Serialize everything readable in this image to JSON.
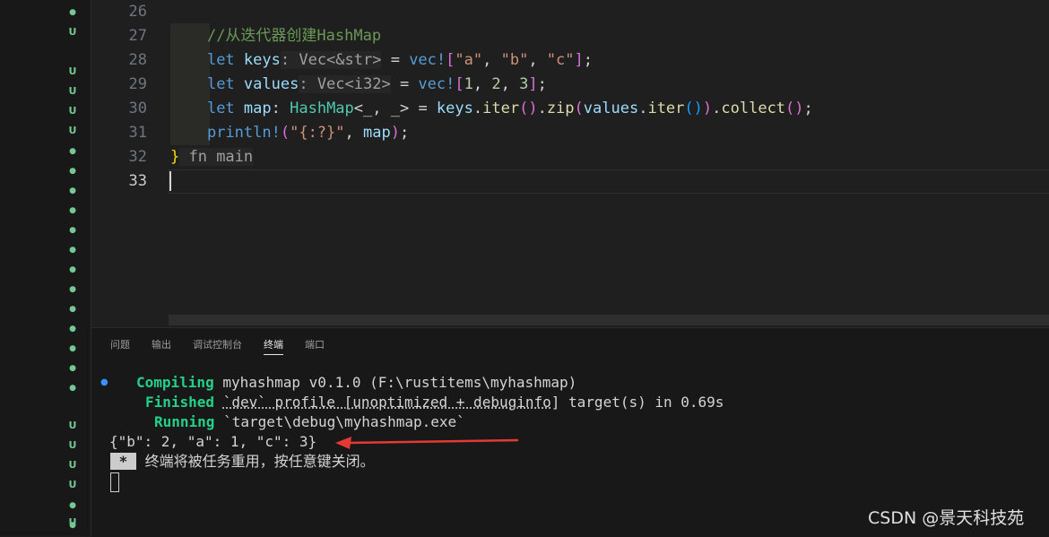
{
  "explorer": {
    "git_markers": [
      "dot",
      "U",
      "U",
      "U",
      "U",
      "U",
      "dot",
      "dot",
      "dot",
      "dot",
      "dot",
      "dot",
      "dot",
      "dot",
      "dot",
      "dot",
      "dot",
      "dot",
      "dot",
      "U",
      "U",
      "U",
      "U",
      "dot",
      "dot",
      "U"
    ]
  },
  "editor": {
    "lines": [
      {
        "num": "26",
        "tokens": []
      },
      {
        "num": "27",
        "tokens": [
          {
            "t": "    "
          },
          {
            "t": "//从迭代器创建HashMap",
            "c": "cm"
          }
        ]
      },
      {
        "num": "28",
        "tokens": [
          {
            "t": "    "
          },
          {
            "t": "let",
            "c": "kw"
          },
          {
            "t": " "
          },
          {
            "t": "keys",
            "c": "var"
          },
          {
            "t": ": Vec<&str>",
            "c": "hint"
          },
          {
            "t": " = "
          },
          {
            "t": "vec!",
            "c": "kw"
          },
          {
            "t": "[",
            "c": "b2"
          },
          {
            "t": "\"a\"",
            "c": "str"
          },
          {
            "t": ", "
          },
          {
            "t": "\"b\"",
            "c": "str"
          },
          {
            "t": ", "
          },
          {
            "t": "\"c\"",
            "c": "str"
          },
          {
            "t": "]",
            "c": "b2"
          },
          {
            "t": ";"
          }
        ]
      },
      {
        "num": "29",
        "tokens": [
          {
            "t": "    "
          },
          {
            "t": "let",
            "c": "kw"
          },
          {
            "t": " "
          },
          {
            "t": "values",
            "c": "var"
          },
          {
            "t": ": Vec<i32>",
            "c": "hint"
          },
          {
            "t": " = "
          },
          {
            "t": "vec!",
            "c": "kw"
          },
          {
            "t": "[",
            "c": "b2"
          },
          {
            "t": "1",
            "c": "num"
          },
          {
            "t": ", "
          },
          {
            "t": "2",
            "c": "num"
          },
          {
            "t": ", "
          },
          {
            "t": "3",
            "c": "num"
          },
          {
            "t": "]",
            "c": "b2"
          },
          {
            "t": ";"
          }
        ]
      },
      {
        "num": "30",
        "tokens": [
          {
            "t": "    "
          },
          {
            "t": "let",
            "c": "kw"
          },
          {
            "t": " "
          },
          {
            "t": "map",
            "c": "var"
          },
          {
            "t": ": "
          },
          {
            "t": "HashMap",
            "c": "ty"
          },
          {
            "t": "<_, _>"
          },
          {
            "t": " = "
          },
          {
            "t": "keys",
            "c": "var"
          },
          {
            "t": "."
          },
          {
            "t": "iter",
            "c": "fn"
          },
          {
            "t": "()",
            "c": "b2"
          },
          {
            "t": "."
          },
          {
            "t": "zip",
            "c": "fn"
          },
          {
            "t": "(",
            "c": "b2"
          },
          {
            "t": "values",
            "c": "var"
          },
          {
            "t": "."
          },
          {
            "t": "iter",
            "c": "fn"
          },
          {
            "t": "()",
            "c": "b3"
          },
          {
            "t": ")",
            "c": "b2"
          },
          {
            "t": "."
          },
          {
            "t": "collect",
            "c": "fn"
          },
          {
            "t": "()",
            "c": "b2"
          },
          {
            "t": ";"
          }
        ]
      },
      {
        "num": "31",
        "tokens": [
          {
            "t": "    "
          },
          {
            "t": "println!",
            "c": "kw"
          },
          {
            "t": "(",
            "c": "b2"
          },
          {
            "t": "\"{:?}\"",
            "c": "str"
          },
          {
            "t": ", "
          },
          {
            "t": "map",
            "c": "var"
          },
          {
            "t": ")",
            "c": "b2"
          },
          {
            "t": ";"
          }
        ]
      },
      {
        "num": "32",
        "tokens": [
          {
            "t": "}",
            "c": "b1"
          },
          {
            "t": " fn main",
            "c": "hint"
          }
        ]
      },
      {
        "num": "33",
        "tokens": []
      }
    ]
  },
  "panel": {
    "tabs": [
      "问题",
      "输出",
      "调试控制台",
      "终端",
      "端口"
    ],
    "active_tab": "终端",
    "terminal": {
      "compiling_label": "Compiling",
      "compiling_text": "myhashmap v0.1.0 (F:\\rustitems\\myhashmap)",
      "finished_label": "Finished",
      "finished_profile": "`dev` profile [unoptimized + debuginfo]",
      "finished_rest": "target(s) in 0.69s",
      "running_label": "Running",
      "running_text": "`target\\debug\\myhashmap.exe`",
      "output": "{\"b\": 2, \"a\": 1, \"c\": 3}",
      "star": "*",
      "notice": "终端将被任务重用，按任意键关闭。"
    }
  },
  "annotation": {
    "color": "#e53935"
  },
  "watermark": "CSDN @景天科技苑"
}
